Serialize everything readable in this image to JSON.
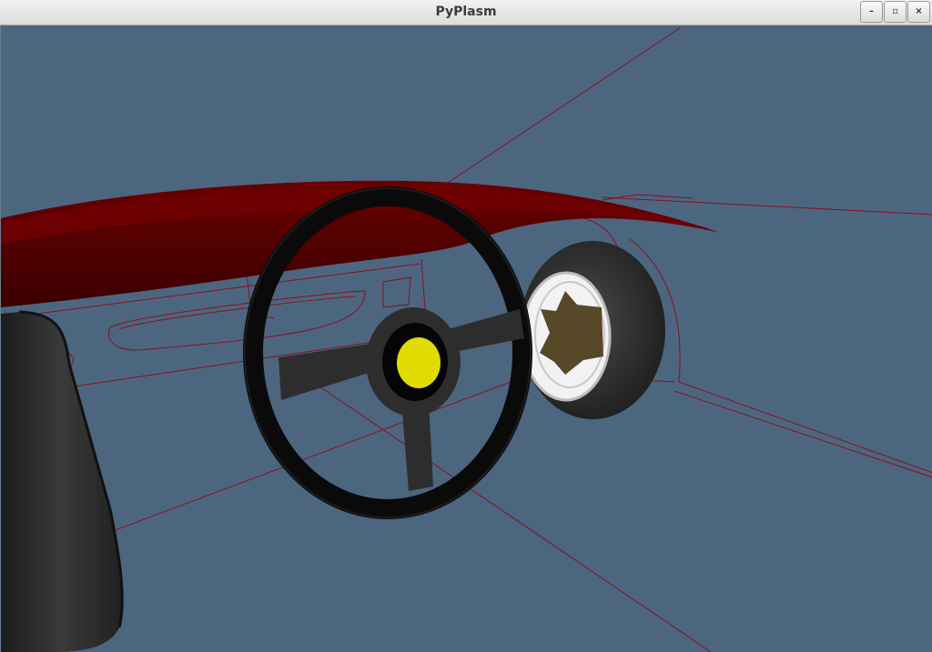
{
  "window": {
    "title": "PyPlasm",
    "buttons": {
      "minimize": "–",
      "maximize": "▫",
      "close": "×"
    }
  },
  "viewport": {
    "background_color": "#4c6680"
  },
  "scene": {
    "colors": {
      "wireframe": "#8a0f1a",
      "body_panel": "#5a0000",
      "body_panel_dark": "#3a0000",
      "steering_wheel": "#0a0a0a",
      "steering_spoke": "#2d2d2d",
      "horn_button": "#e1dc00",
      "tyre": "#2a2a2a",
      "rim": "#f0f0f0",
      "hub": "#574828"
    }
  }
}
